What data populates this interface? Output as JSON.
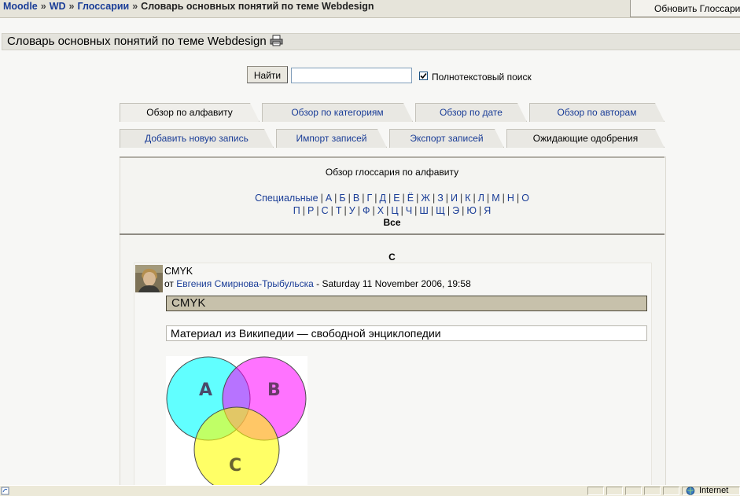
{
  "breadcrumb": {
    "items": [
      "Moodle",
      "WD",
      "Глоссарии"
    ],
    "separator": "»",
    "current": "Словарь основных понятий по теме Webdesign"
  },
  "update_button": "Обновить Глоссарий",
  "page_title": "Словарь основных понятий по теме Webdesign",
  "search": {
    "button": "Найти",
    "value": "",
    "fulltext_label": "Полнотекстовый поиск",
    "fulltext_checked": true
  },
  "tabs_row1": [
    "Обзор по алфавиту",
    "Обзор по категориям",
    "Обзор по дате",
    "Обзор по авторам"
  ],
  "tabs_row2": [
    "Добавить новую запись",
    "Импорт записей",
    "Экспорт записей",
    "Ожидающие одобрения"
  ],
  "browse_title": "Обзор глоссария по алфавиту",
  "alphabet_row1": [
    "Специальные",
    "А",
    "Б",
    "В",
    "Г",
    "Д",
    "Е",
    "Ё",
    "Ж",
    "З",
    "И",
    "К",
    "Л",
    "М",
    "Н",
    "О"
  ],
  "alphabet_row2": [
    "П",
    "Р",
    "С",
    "Т",
    "У",
    "Ф",
    "Х",
    "Ц",
    "Ч",
    "Ш",
    "Щ",
    "Э",
    "Ю",
    "Я"
  ],
  "all_label": "Все",
  "letter_heading": "C",
  "entry": {
    "concept": "CMYK",
    "by_prefix": "от",
    "author": "Евгения Смирнова-Трыбульска",
    "date": "- Saturday 11 November 2006, 19:58",
    "concept_box": "CMYK",
    "source_box": "Материал из Википедии — свободной энциклопедии",
    "venn_labels": [
      "A",
      "B",
      "C"
    ]
  },
  "status": {
    "zone": "Internet"
  },
  "colors": {
    "link": "#1a3d97",
    "concept_bg": "#c7c1ab",
    "cyan": "#00ffff",
    "magenta": "#ff00ff",
    "yellow": "#ffff00"
  }
}
